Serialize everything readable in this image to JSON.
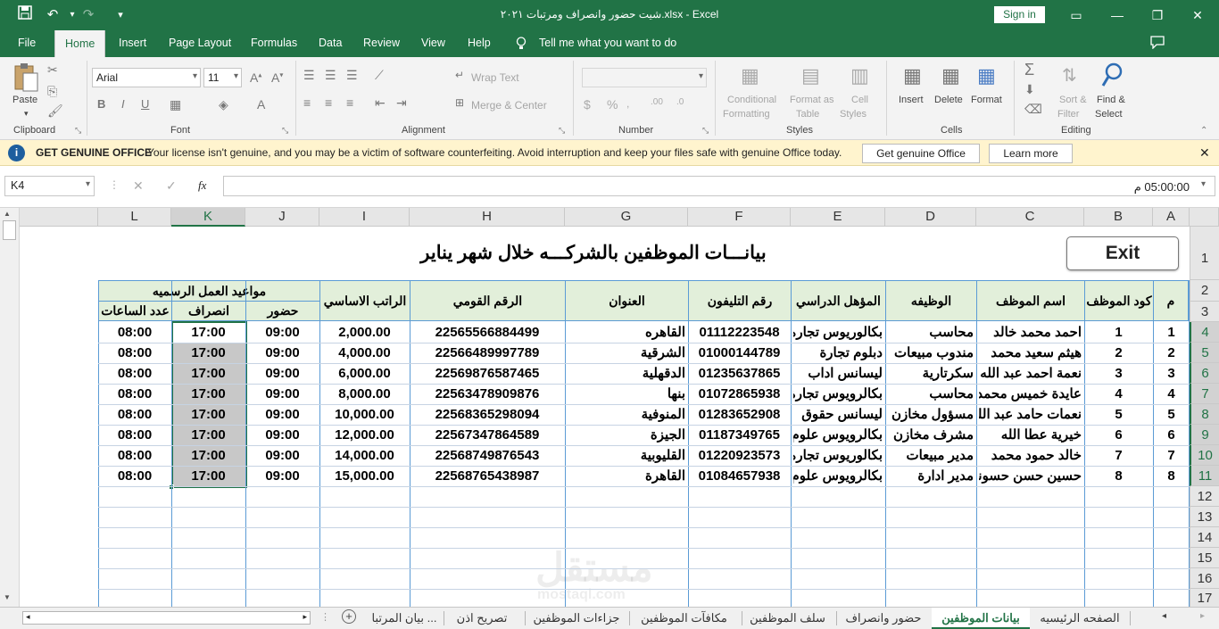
{
  "window": {
    "title": "شيت حضور وانصراف ومرتبات ٢٠٢١.xlsx - Excel",
    "sign_in": "Sign in",
    "undo_glyph": "↶",
    "redo_glyph": "↷",
    "save_glyph": "💾",
    "customize_glyph": "▾",
    "min_glyph": "—",
    "restore_glyph": "❐",
    "close_glyph": "✕",
    "ribbon_display_glyph": "▭"
  },
  "ribbon_tabs": [
    "File",
    "Home",
    "Insert",
    "Page Layout",
    "Formulas",
    "Data",
    "Review",
    "View",
    "Help"
  ],
  "active_tab": "Home",
  "tell_me": "Tell me what you want to do",
  "ribbon": {
    "clipboard": {
      "paste": "Paste",
      "group": "Clipboard"
    },
    "font": {
      "name": "Arial",
      "size": "11",
      "bold": "B",
      "italic": "I",
      "underline": "U",
      "group": "Font"
    },
    "alignment": {
      "wrap": "Wrap Text",
      "merge": "Merge & Center",
      "group": "Alignment"
    },
    "number": {
      "group": "Number"
    },
    "styles": {
      "cond1": "Conditional",
      "cond2": "Formatting",
      "fmt1": "Format as",
      "fmt2": "Table",
      "cell1": "Cell",
      "cell2": "Styles",
      "group": "Styles"
    },
    "cells": {
      "insert": "Insert",
      "delete": "Delete",
      "format": "Format",
      "group": "Cells"
    },
    "editing": {
      "sort1": "Sort &",
      "sort2": "Filter",
      "find1": "Find &",
      "find2": "Select",
      "group": "Editing"
    }
  },
  "message_bar": {
    "title": "GET GENUINE OFFICE",
    "text": "Your license isn't genuine, and you may be a victim of software counterfeiting. Avoid interruption and keep your files safe with genuine Office today.",
    "btn_genuine": "Get genuine Office",
    "btn_learn": "Learn more",
    "info_glyph": "i"
  },
  "formula_bar": {
    "name_box": "K4",
    "value": "05:00:00 م",
    "fx": "fx",
    "cancel": "✕",
    "enter": "✓"
  },
  "columns": [
    "A",
    "B",
    "C",
    "D",
    "E",
    "F",
    "G",
    "H",
    "I",
    "J",
    "K",
    "L"
  ],
  "selected_column": "K",
  "rows": [
    "1",
    "2",
    "3",
    "4",
    "5",
    "6",
    "7",
    "8",
    "9",
    "10",
    "11",
    "12",
    "13",
    "14",
    "15",
    "16",
    "17"
  ],
  "sheet": {
    "title": "بيانـــات الموظفين بالشركـــه خلال شهر يناير",
    "exit_button": "Exit",
    "headers": {
      "m": "م",
      "code": "كود الموظف",
      "name": "اسم الموظف",
      "job": "الوظيفه",
      "qualification": "المؤهل الدراسي",
      "phone": "رقم التليفون",
      "address": "العنوان",
      "national_id": "الرقم القومي",
      "salary": "الراتب الاساسي",
      "work_hours": "مواعيد العمل الرسميه",
      "attend": "حضور",
      "leave": "انصراف",
      "hours_count": "عدد الساعات"
    },
    "records": [
      {
        "m": "1",
        "code": "1",
        "name": "احمد محمد خالد",
        "job": "محاسب",
        "qual": "بكالوريوس تجاره",
        "phone": "01112223548",
        "addr": "القاهره",
        "nid": "22565566884499",
        "salary": "2,000.00",
        "attend": "09:00",
        "leave": "17:00",
        "hours": "08:00"
      },
      {
        "m": "2",
        "code": "2",
        "name": "هيثم سعيد محمد",
        "job": "مندوب مبيعات",
        "qual": "دبلوم تجارة",
        "phone": "01000144789",
        "addr": "الشرقية",
        "nid": "22566489997789",
        "salary": "4,000.00",
        "attend": "09:00",
        "leave": "17:00",
        "hours": "08:00"
      },
      {
        "m": "3",
        "code": "3",
        "name": "نعمة احمد عبد الله",
        "job": "سكرتارية",
        "qual": "ليسانس اداب",
        "phone": "01235637865",
        "addr": "الدقهلية",
        "nid": "22569876587465",
        "salary": "6,000.00",
        "attend": "09:00",
        "leave": "17:00",
        "hours": "08:00"
      },
      {
        "m": "4",
        "code": "4",
        "name": "عايدة خميس محمد",
        "job": "محاسب",
        "qual": "بكالرويوس تجارة",
        "phone": "01072865938",
        "addr": "بنها",
        "nid": "22563478909876",
        "salary": "8,000.00",
        "attend": "09:00",
        "leave": "17:00",
        "hours": "08:00"
      },
      {
        "m": "5",
        "code": "5",
        "name": "نعمات حامد عبد الله",
        "job": "مسؤول مخازن",
        "qual": "ليسانس حقوق",
        "phone": "01283652908",
        "addr": "المنوفية",
        "nid": "22568365298094",
        "salary": "10,000.00",
        "attend": "09:00",
        "leave": "17:00",
        "hours": "08:00"
      },
      {
        "m": "6",
        "code": "6",
        "name": "خيرية عطا الله",
        "job": "مشرف مخازن",
        "qual": "بكالرويوس علوم",
        "phone": "01187349765",
        "addr": "الجيزة",
        "nid": "22567347864589",
        "salary": "12,000.00",
        "attend": "09:00",
        "leave": "17:00",
        "hours": "08:00"
      },
      {
        "m": "7",
        "code": "7",
        "name": "خالد حمود محمد",
        "job": "مدير مبيعات",
        "qual": "بكالوريوس تجاره",
        "phone": "01220923573",
        "addr": "القليوبية",
        "nid": "22568749876543",
        "salary": "14,000.00",
        "attend": "09:00",
        "leave": "17:00",
        "hours": "08:00"
      },
      {
        "m": "8",
        "code": "8",
        "name": "حسين حسن حسونة",
        "job": "مدير ادارة",
        "qual": "بكالرويوس علوم",
        "phone": "01084657938",
        "addr": "القاهرة",
        "nid": "22568765438987",
        "salary": "15,000.00",
        "attend": "09:00",
        "leave": "17:00",
        "hours": "08:00"
      }
    ]
  },
  "sheet_tabs": [
    "بيان المرتبا ...",
    "تصريح اذن",
    "جزاءات الموظفين",
    "مكافآت الموظفين",
    "سلف الموظفين",
    "حضور وانصراف",
    "بيانات الموظفين",
    "الصفحه الرئيسيه"
  ],
  "active_sheet": "بيانات الموظفين",
  "tab_nav": {
    "prev": "◂",
    "next": "▸",
    "add": "+"
  },
  "watermark": {
    "main": "مستقل",
    "sub": "mostaql.com"
  }
}
